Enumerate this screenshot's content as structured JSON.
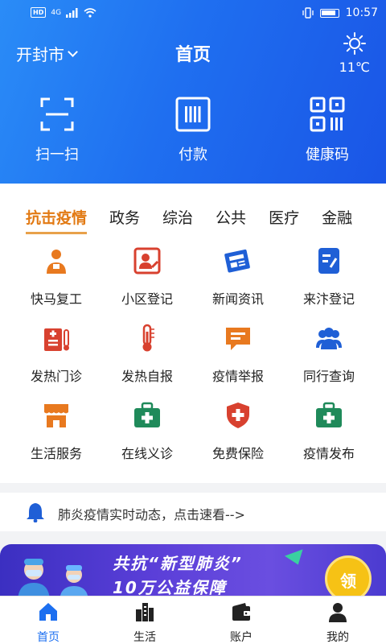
{
  "status": {
    "time": "10:57",
    "network": "4G",
    "hd": "HD"
  },
  "header": {
    "city": "开封市",
    "title": "首页",
    "temperature": "11℃",
    "weather_icon": "sun-icon"
  },
  "quick_actions": [
    {
      "label": "扫一扫",
      "icon": "scan-icon"
    },
    {
      "label": "付款",
      "icon": "payment-code-icon"
    },
    {
      "label": "健康码",
      "icon": "qr-code-icon"
    }
  ],
  "tabs": [
    {
      "label": "抗击疫情",
      "active": true
    },
    {
      "label": "政务"
    },
    {
      "label": "综治"
    },
    {
      "label": "公共"
    },
    {
      "label": "医疗"
    },
    {
      "label": "金融"
    }
  ],
  "services": [
    {
      "label": "快马复工",
      "icon": "worker-icon",
      "color": "#e8791f"
    },
    {
      "label": "小区登记",
      "icon": "id-card-icon",
      "color": "#d8412f"
    },
    {
      "label": "新闻资讯",
      "icon": "newspaper-icon",
      "color": "#1f5fd6"
    },
    {
      "label": "来汴登记",
      "icon": "form-icon",
      "color": "#1f5fd6"
    },
    {
      "label": "发热门诊",
      "icon": "clinic-icon",
      "color": "#d8412f"
    },
    {
      "label": "发热自报",
      "icon": "thermometer-icon",
      "color": "#d8412f"
    },
    {
      "label": "疫情举报",
      "icon": "report-icon",
      "color": "#e8791f"
    },
    {
      "label": "同行查询",
      "icon": "group-icon",
      "color": "#1f5fd6"
    },
    {
      "label": "生活服务",
      "icon": "shop-icon",
      "color": "#e8791f"
    },
    {
      "label": "在线义诊",
      "icon": "medkit-icon",
      "color": "#1f8a5a"
    },
    {
      "label": "免费保险",
      "icon": "shield-plus-icon",
      "color": "#d8412f"
    },
    {
      "label": "疫情发布",
      "icon": "medkit-icon",
      "color": "#1f8a5a"
    }
  ],
  "notice": {
    "text": "肺炎疫情实时动态，点击速看-->"
  },
  "banner": {
    "line1": "共抗“新型肺炎”",
    "line2": "10万公益保障",
    "button": "领"
  },
  "nav": [
    {
      "label": "首页",
      "icon": "home-icon",
      "active": true
    },
    {
      "label": "生活",
      "icon": "city-icon"
    },
    {
      "label": "账户",
      "icon": "wallet-icon"
    },
    {
      "label": "我的",
      "icon": "person-icon"
    }
  ]
}
